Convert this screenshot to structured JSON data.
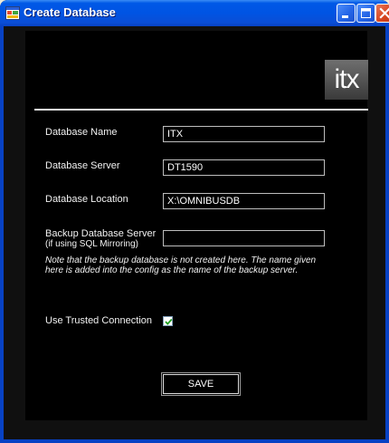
{
  "window": {
    "title": "Create Database",
    "icon": "app-window-icon",
    "controls": [
      "minimize-icon",
      "maximize-icon",
      "close-icon"
    ]
  },
  "logo": {
    "text": "itx"
  },
  "form": {
    "database_name": {
      "label": "Database Name",
      "value": "ITX"
    },
    "database_server": {
      "label": "Database Server",
      "value": "DT1590"
    },
    "database_location": {
      "label": "Database Location",
      "value": "X:\\OMNIBUSDB"
    },
    "backup_server": {
      "label_line1": "Backup Database Server",
      "label_line2": "(if using SQL Mirroring)",
      "value": ""
    },
    "note_line1": "Note that the backup database is not created here.  The name given",
    "note_line2": "here is added into the config as the name of the backup server.",
    "trusted_connection": {
      "label": "Use Trusted Connection",
      "checked": true
    },
    "save_label": "SAVE"
  },
  "colors": {
    "titlebar": "#0054e3",
    "background": "#000000",
    "text": "#f2f2f2",
    "checkbox_check": "#21a121"
  }
}
